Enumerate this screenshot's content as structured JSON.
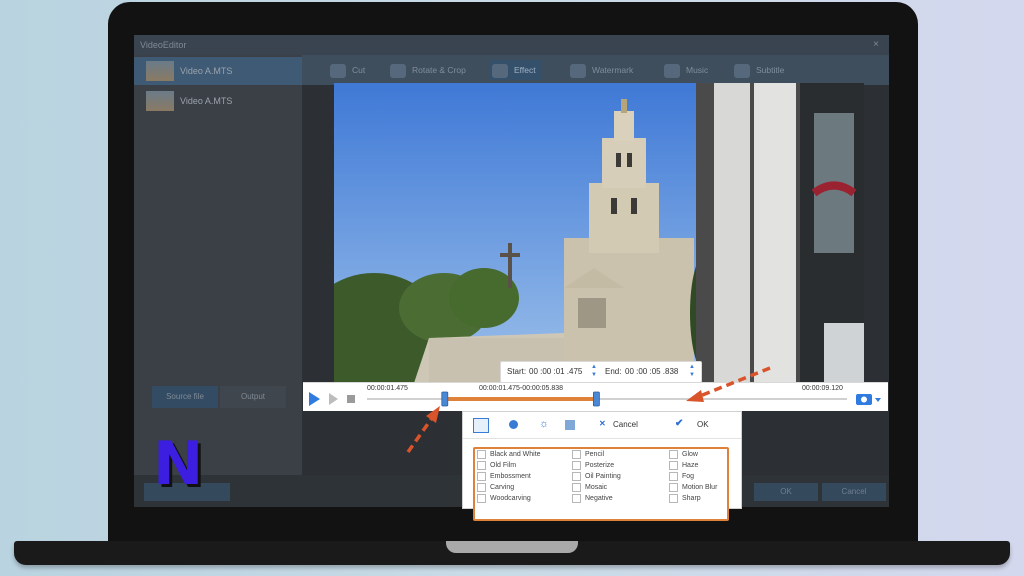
{
  "app": {
    "title": "VideoEditor",
    "close_glyph": "×"
  },
  "files": [
    {
      "name": "Video A.MTS"
    },
    {
      "name": "Video A.MTS"
    }
  ],
  "side_tabs": {
    "tab1": "Source file",
    "tab2": "Output"
  },
  "toolbar": {
    "items": [
      {
        "label": "Cut",
        "icon": "cut-icon"
      },
      {
        "label": "Rotate & Crop",
        "icon": "rotate-crop-icon"
      },
      {
        "label": "Effect",
        "icon": "effect-icon"
      },
      {
        "label": "Watermark",
        "icon": "watermark-icon"
      },
      {
        "label": "Music",
        "icon": "music-icon"
      },
      {
        "label": "Subtitle",
        "icon": "subtitle-icon"
      }
    ]
  },
  "bottom": {
    "export": "",
    "ok": "OK",
    "cancel": "Cancel"
  },
  "trim": {
    "start_label": "Start:",
    "start_value": "00 :00 :01 .475",
    "end_label": "End:",
    "end_value": "00 :00 :05 .838",
    "current_time": "00:00:01.475",
    "range_time": "00:00:01.475-00:00:05.838",
    "total_time": "00:00:09.120",
    "start_fraction": 0.162,
    "end_fraction": 0.478
  },
  "effects": {
    "cancel": "Cancel",
    "ok": "OK",
    "col1": [
      "Black and White",
      "Old Film",
      "Embossment",
      "Carving",
      "Woodcarving"
    ],
    "col2": [
      "Pencil",
      "Posterize",
      "Oil Painting",
      "Mosaic",
      "Negative"
    ],
    "col3": [
      "Glow",
      "Haze",
      "Fog",
      "Motion Blur",
      "Sharp"
    ]
  },
  "logo": {
    "letter": "N"
  },
  "colors": {
    "accent_orange": "#e0813a",
    "annotation_arrow": "#d9542b",
    "play_blue": "#2f7be0",
    "logo_fill": "#3b1ee0"
  }
}
